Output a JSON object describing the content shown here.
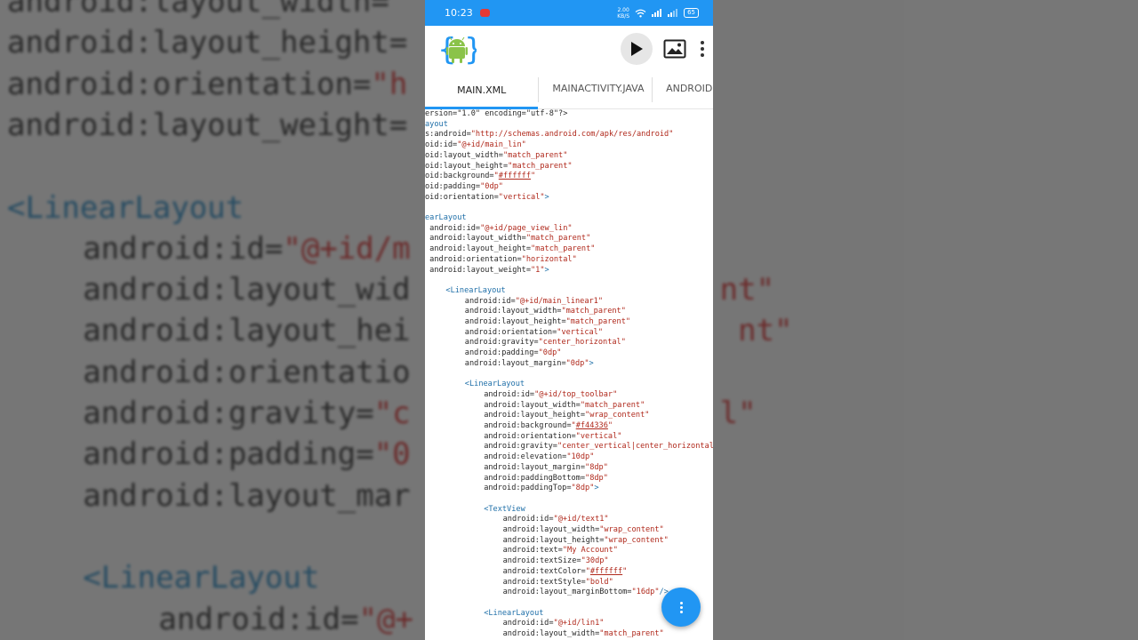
{
  "background_code": [
    {
      "indent": "",
      "parts": [
        [
          "a",
          "android:layout_width="
        ]
      ]
    },
    {
      "indent": "",
      "parts": [
        [
          "a",
          "android:layout_height="
        ]
      ]
    },
    {
      "indent": "",
      "parts": [
        [
          "a",
          "android:orientation="
        ],
        [
          "v",
          "\"h"
        ]
      ]
    },
    {
      "indent": "",
      "parts": [
        [
          "a",
          "android:layout_weight="
        ]
      ]
    },
    {
      "indent": "",
      "parts": []
    },
    {
      "indent": "",
      "parts": [
        [
          "t",
          "<LinearLayout"
        ]
      ]
    },
    {
      "indent": "    ",
      "parts": [
        [
          "a",
          "android:id="
        ],
        [
          "v",
          "\"@+id/m"
        ]
      ]
    },
    {
      "indent": "    ",
      "parts": [
        [
          "a",
          "android:layout_wid"
        ],
        [
          "v",
          "                 nt\""
        ]
      ]
    },
    {
      "indent": "    ",
      "parts": [
        [
          "a",
          "android:layout_hei"
        ],
        [
          "v",
          "                  nt\""
        ]
      ]
    },
    {
      "indent": "    ",
      "parts": [
        [
          "a",
          "android:orientatio"
        ]
      ]
    },
    {
      "indent": "    ",
      "parts": [
        [
          "a",
          "android:gravity="
        ],
        [
          "v",
          "\"c                 l\""
        ]
      ]
    },
    {
      "indent": "    ",
      "parts": [
        [
          "a",
          "android:padding="
        ],
        [
          "v",
          "\"0"
        ]
      ]
    },
    {
      "indent": "    ",
      "parts": [
        [
          "a",
          "android:layout_mar"
        ]
      ]
    },
    {
      "indent": "",
      "parts": []
    },
    {
      "indent": "    ",
      "parts": [
        [
          "t",
          "<LinearLayout"
        ]
      ]
    },
    {
      "indent": "        ",
      "parts": [
        [
          "a",
          "android:id="
        ],
        [
          "v",
          "\"@+"
        ]
      ]
    }
  ],
  "status": {
    "time": "10:23",
    "net_speed_top": "2.00",
    "net_speed_bottom": "KB/S",
    "battery": "65"
  },
  "tabs": [
    "MAIN.XML",
    "MAINACTIVITY.JAVA",
    "ANDROIDMANIFEST.XML"
  ],
  "code_lines": [
    {
      "i": 0,
      "parts": [
        [
          "a",
          "ersion=\"1.0\" encoding=\"utf-8\"?>"
        ]
      ]
    },
    {
      "i": 0,
      "parts": [
        [
          "t",
          "ayout"
        ]
      ]
    },
    {
      "i": 0,
      "parts": [
        [
          "a",
          "s:android="
        ],
        [
          "v",
          "\"http://schemas.android.com/apk/res/android\""
        ]
      ]
    },
    {
      "i": 0,
      "parts": [
        [
          "a",
          "oid:id="
        ],
        [
          "v",
          "\"@+id/main_lin\""
        ]
      ]
    },
    {
      "i": 0,
      "parts": [
        [
          "a",
          "oid:layout_width="
        ],
        [
          "v",
          "\"match_parent\""
        ]
      ]
    },
    {
      "i": 0,
      "parts": [
        [
          "a",
          "oid:layout_height="
        ],
        [
          "v",
          "\"match_parent\""
        ]
      ]
    },
    {
      "i": 0,
      "parts": [
        [
          "a",
          "oid:background="
        ],
        [
          "v",
          "\""
        ],
        [
          "u",
          "#ffffff"
        ],
        [
          "v",
          "\""
        ]
      ]
    },
    {
      "i": 0,
      "parts": [
        [
          "a",
          "oid:padding="
        ],
        [
          "v",
          "\"0dp\""
        ]
      ]
    },
    {
      "i": 0,
      "parts": [
        [
          "a",
          "oid:orientation="
        ],
        [
          "v",
          "\"vertical\""
        ],
        [
          "t",
          ">"
        ]
      ]
    },
    {
      "i": 0,
      "parts": []
    },
    {
      "i": 0,
      "parts": [
        [
          "t",
          "earLayout"
        ]
      ]
    },
    {
      "i": 0,
      "parts": [
        [
          "a",
          " android:id="
        ],
        [
          "v",
          "\"@+id/page_view_lin\""
        ]
      ]
    },
    {
      "i": 0,
      "parts": [
        [
          "a",
          " android:layout_width="
        ],
        [
          "v",
          "\"match_parent\""
        ]
      ]
    },
    {
      "i": 0,
      "parts": [
        [
          "a",
          " android:layout_height="
        ],
        [
          "v",
          "\"match_parent\""
        ]
      ]
    },
    {
      "i": 0,
      "parts": [
        [
          "a",
          " android:orientation="
        ],
        [
          "v",
          "\"horizontal\""
        ]
      ]
    },
    {
      "i": 0,
      "parts": [
        [
          "a",
          " android:layout_weight="
        ],
        [
          "v",
          "\"1\""
        ],
        [
          "t",
          ">"
        ]
      ]
    },
    {
      "i": 0,
      "parts": []
    },
    {
      "i": 1,
      "parts": [
        [
          "t",
          "<LinearLayout"
        ]
      ]
    },
    {
      "i": 2,
      "parts": [
        [
          "a",
          "android:id="
        ],
        [
          "v",
          "\"@+id/main_linear1\""
        ]
      ]
    },
    {
      "i": 2,
      "parts": [
        [
          "a",
          "android:layout_width="
        ],
        [
          "v",
          "\"match_parent\""
        ]
      ]
    },
    {
      "i": 2,
      "parts": [
        [
          "a",
          "android:layout_height="
        ],
        [
          "v",
          "\"match_parent\""
        ]
      ]
    },
    {
      "i": 2,
      "parts": [
        [
          "a",
          "android:orientation="
        ],
        [
          "v",
          "\"vertical\""
        ]
      ]
    },
    {
      "i": 2,
      "parts": [
        [
          "a",
          "android:gravity="
        ],
        [
          "v",
          "\"center_horizontal\""
        ]
      ]
    },
    {
      "i": 2,
      "parts": [
        [
          "a",
          "android:padding="
        ],
        [
          "v",
          "\"0dp\""
        ]
      ]
    },
    {
      "i": 2,
      "parts": [
        [
          "a",
          "android:layout_margin="
        ],
        [
          "v",
          "\"0dp\""
        ],
        [
          "t",
          ">"
        ]
      ]
    },
    {
      "i": 2,
      "parts": []
    },
    {
      "i": 2,
      "parts": [
        [
          "t",
          "<LinearLayout"
        ]
      ]
    },
    {
      "i": 3,
      "parts": [
        [
          "a",
          "android:id="
        ],
        [
          "v",
          "\"@+id/top_toolbar\""
        ]
      ]
    },
    {
      "i": 3,
      "parts": [
        [
          "a",
          "android:layout_width="
        ],
        [
          "v",
          "\"match_parent\""
        ]
      ]
    },
    {
      "i": 3,
      "parts": [
        [
          "a",
          "android:layout_height="
        ],
        [
          "v",
          "\"wrap_content\""
        ]
      ]
    },
    {
      "i": 3,
      "parts": [
        [
          "a",
          "android:background="
        ],
        [
          "v",
          "\""
        ],
        [
          "u",
          "#f44336"
        ],
        [
          "v",
          "\""
        ]
      ]
    },
    {
      "i": 3,
      "parts": [
        [
          "a",
          "android:orientation="
        ],
        [
          "v",
          "\"vertical\""
        ]
      ]
    },
    {
      "i": 3,
      "parts": [
        [
          "a",
          "android:gravity="
        ],
        [
          "v",
          "\"center_vertical|center_horizontal\""
        ]
      ]
    },
    {
      "i": 3,
      "parts": [
        [
          "a",
          "android:elevation="
        ],
        [
          "v",
          "\"10dp\""
        ]
      ]
    },
    {
      "i": 3,
      "parts": [
        [
          "a",
          "android:layout_margin="
        ],
        [
          "v",
          "\"8dp\""
        ]
      ]
    },
    {
      "i": 3,
      "parts": [
        [
          "a",
          "android:paddingBottom="
        ],
        [
          "v",
          "\"8dp\""
        ]
      ]
    },
    {
      "i": 3,
      "parts": [
        [
          "a",
          "android:paddingTop="
        ],
        [
          "v",
          "\"8dp\""
        ],
        [
          "t",
          ">"
        ]
      ]
    },
    {
      "i": 3,
      "parts": []
    },
    {
      "i": 3,
      "parts": [
        [
          "t",
          "<TextView"
        ]
      ]
    },
    {
      "i": 4,
      "parts": [
        [
          "a",
          "android:id="
        ],
        [
          "v",
          "\"@+id/text1\""
        ]
      ]
    },
    {
      "i": 4,
      "parts": [
        [
          "a",
          "android:layout_width="
        ],
        [
          "v",
          "\"wrap_content\""
        ]
      ]
    },
    {
      "i": 4,
      "parts": [
        [
          "a",
          "android:layout_height="
        ],
        [
          "v",
          "\"wrap_content\""
        ]
      ]
    },
    {
      "i": 4,
      "parts": [
        [
          "a",
          "android:text="
        ],
        [
          "v",
          "\"My Account\""
        ]
      ]
    },
    {
      "i": 4,
      "parts": [
        [
          "a",
          "android:textSize="
        ],
        [
          "v",
          "\"30dp\""
        ]
      ]
    },
    {
      "i": 4,
      "parts": [
        [
          "a",
          "android:textColor="
        ],
        [
          "v",
          "\""
        ],
        [
          "u",
          "#ffffff"
        ],
        [
          "v",
          "\""
        ]
      ]
    },
    {
      "i": 4,
      "parts": [
        [
          "a",
          "android:textStyle="
        ],
        [
          "v",
          "\"bold\""
        ]
      ]
    },
    {
      "i": 4,
      "parts": [
        [
          "a",
          "android:layout_marginBottom="
        ],
        [
          "v",
          "\"16dp\""
        ],
        [
          "t",
          "/>"
        ]
      ]
    },
    {
      "i": 3,
      "parts": []
    },
    {
      "i": 3,
      "parts": [
        [
          "t",
          "<LinearLayout"
        ]
      ]
    },
    {
      "i": 4,
      "parts": [
        [
          "a",
          "android:id="
        ],
        [
          "v",
          "\"@+id/lin1\""
        ]
      ]
    },
    {
      "i": 4,
      "parts": [
        [
          "a",
          "android:layout_width="
        ],
        [
          "v",
          "\"match_parent\""
        ]
      ]
    }
  ],
  "colors": {
    "accent": "#2196f3",
    "tag": "#1f6fa8",
    "value": "#b0291c",
    "fab": "#2196f3"
  },
  "icons": [
    "android-logo-icon",
    "play-icon",
    "image-icon",
    "more-vert-icon",
    "fab-menu-icon"
  ]
}
